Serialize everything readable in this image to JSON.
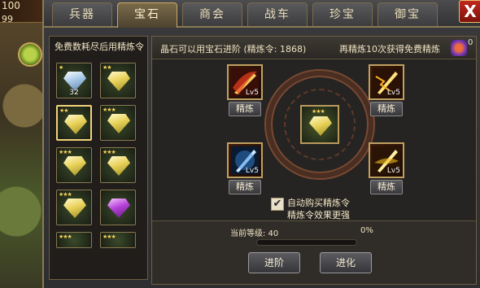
{
  "background": {
    "stat_top": "100",
    "stat_second": "99"
  },
  "tabs": [
    {
      "label": "兵器",
      "active": false
    },
    {
      "label": "宝石",
      "active": true
    },
    {
      "label": "商会",
      "active": false
    },
    {
      "label": "战车",
      "active": false
    },
    {
      "label": "珍宝",
      "active": false
    },
    {
      "label": "御宝",
      "active": false
    }
  ],
  "close_label": "X",
  "gem_list": {
    "title": "免费数耗尽后用精炼令",
    "items": [
      {
        "color": "blue",
        "stars": "★",
        "count": "32"
      },
      {
        "color": "yellow",
        "stars": "★★",
        "count": ""
      },
      {
        "color": "yellow",
        "stars": "★★",
        "count": "",
        "selected": true
      },
      {
        "color": "yellow",
        "stars": "★★★",
        "count": ""
      },
      {
        "color": "yellow",
        "stars": "★★★",
        "count": ""
      },
      {
        "color": "yellow",
        "stars": "★★★",
        "count": ""
      },
      {
        "color": "yellow",
        "stars": "★★★",
        "count": ""
      },
      {
        "color": "purple",
        "stars": "",
        "count": ""
      },
      {
        "color": "yellow",
        "stars": "★★★",
        "count": ""
      },
      {
        "color": "yellow",
        "stars": "★★★",
        "count": ""
      }
    ]
  },
  "info": {
    "left_text": "晶石可以用宝石进阶 (精炼令: 1868)",
    "right_text": "再精炼10次获得免费精炼",
    "token_count": "0"
  },
  "materials": [
    {
      "level": "Lv5",
      "button": "精炼",
      "color": "#e8a030",
      "accent": "#c0281e"
    },
    {
      "level": "Lv5",
      "button": "精炼",
      "color": "#f0b030",
      "accent": "#7a2a10"
    },
    {
      "level": "Lv5",
      "button": "精炼",
      "color": "#3a8ae0",
      "accent": "#0a2a5a"
    },
    {
      "level": "Lv5",
      "button": "精炼",
      "color": "#f0c020",
      "accent": "#7a3a10"
    }
  ],
  "auto_buy": {
    "checked": true,
    "check_mark": "✔",
    "line1": "自动购买精炼令",
    "line2": "精炼令效果更强"
  },
  "progress": {
    "level_text": "当前等级: 40",
    "percent_text": "0%",
    "percent": 0
  },
  "buttons": {
    "advance": "进阶",
    "evolve": "进化"
  }
}
